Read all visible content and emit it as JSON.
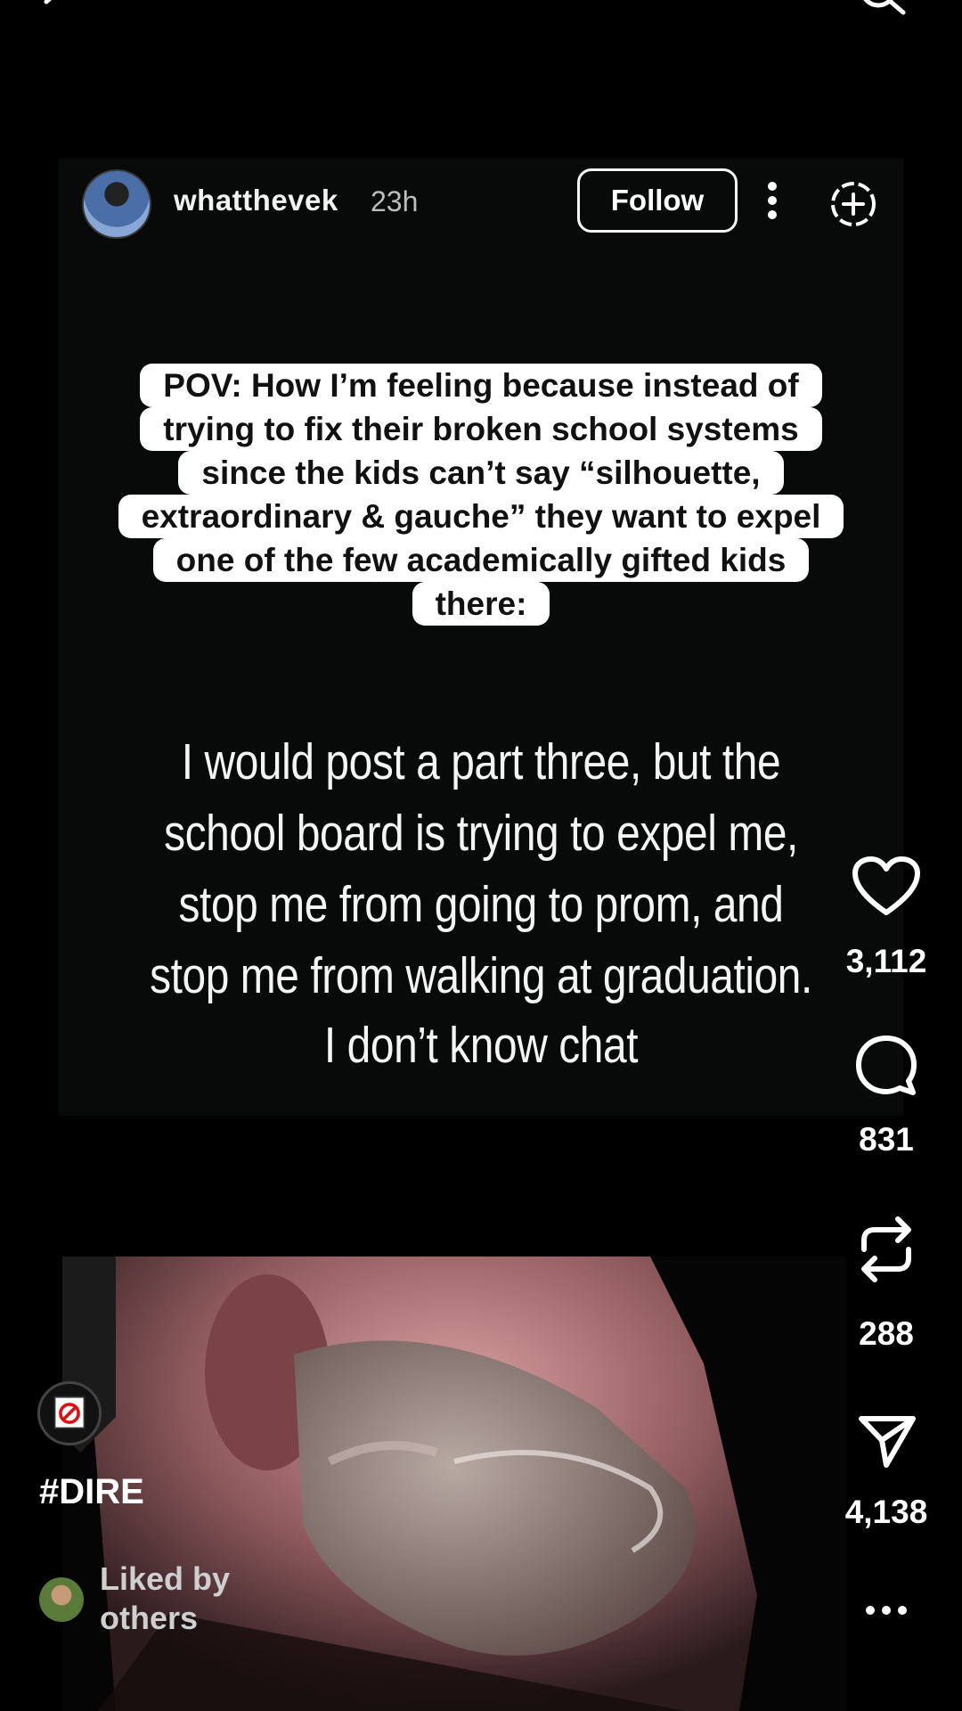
{
  "post": {
    "username": "whatthevek",
    "time": "23h",
    "follow_label": "Follow"
  },
  "caption": {
    "lines": [
      "POV: How I’m feeling because  instead of",
      "trying to fix their broken school systems",
      "since the kids can’t say “silhouette,",
      "extraordinary & gauche” they want to expel",
      "one of the few academically gifted kids",
      "there:"
    ]
  },
  "body_text": {
    "lines": [
      "I would post a part three, but the",
      "school board is trying to expel me,",
      "stop me from going to prom, and",
      "stop me from walking at graduation.",
      "I don’t know chat"
    ]
  },
  "actions": {
    "likes": "3,112",
    "comments": "831",
    "reposts": "288",
    "shares": "4,138"
  },
  "footer": {
    "hashtag": "#DIRE",
    "liked_by_line1": "Liked by",
    "liked_by_line2": "others"
  },
  "colors": {
    "background": "#000000",
    "card": "#070a08",
    "caption_bg": "#ffffff"
  },
  "icons": [
    "back-icon",
    "search-icon",
    "more-vert-icon",
    "add-circle-icon",
    "heart-icon",
    "comment-icon",
    "repost-icon",
    "share-icon",
    "more-horizontal-icon"
  ]
}
